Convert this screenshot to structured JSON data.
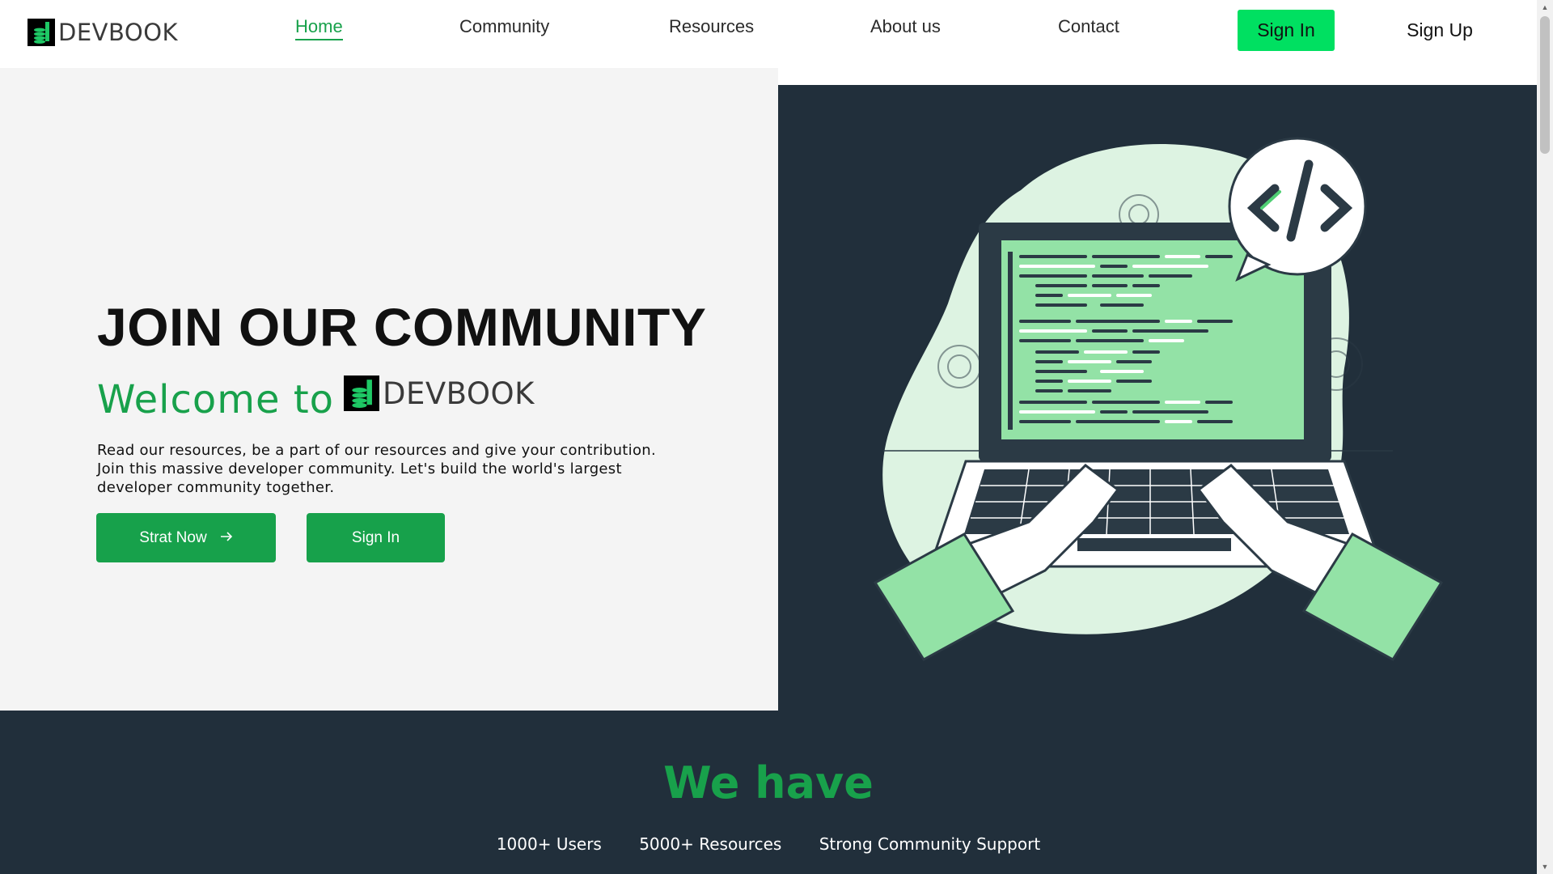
{
  "brand": {
    "name": "DEVBOOK",
    "accent": "#18a14b",
    "dark": "#212f3b",
    "bright_green": "#00e061"
  },
  "nav": {
    "items": [
      {
        "label": "Home",
        "active": true
      },
      {
        "label": "Community",
        "active": false
      },
      {
        "label": "Resources",
        "active": false
      },
      {
        "label": "About us",
        "active": false
      },
      {
        "label": "Contact",
        "active": false
      }
    ],
    "signin_label": "Sign In",
    "signup_label": "Sign Up"
  },
  "hero": {
    "title": "JOIN OUR COMMUNITY",
    "welcome": "Welcome to",
    "description": "Read our resources, be a part of our resources and give your contribution. Join this massive developer community. Let's build the world's largest developer community together.",
    "start_label": "Strat Now",
    "start_icon": "arrow-right-icon",
    "signin_label": "Sign In",
    "illustration": "laptop-coding-illustration"
  },
  "stats": {
    "title": "We have",
    "items": [
      "1000+ Users",
      "5000+ Resources",
      "Strong Community Support"
    ]
  }
}
